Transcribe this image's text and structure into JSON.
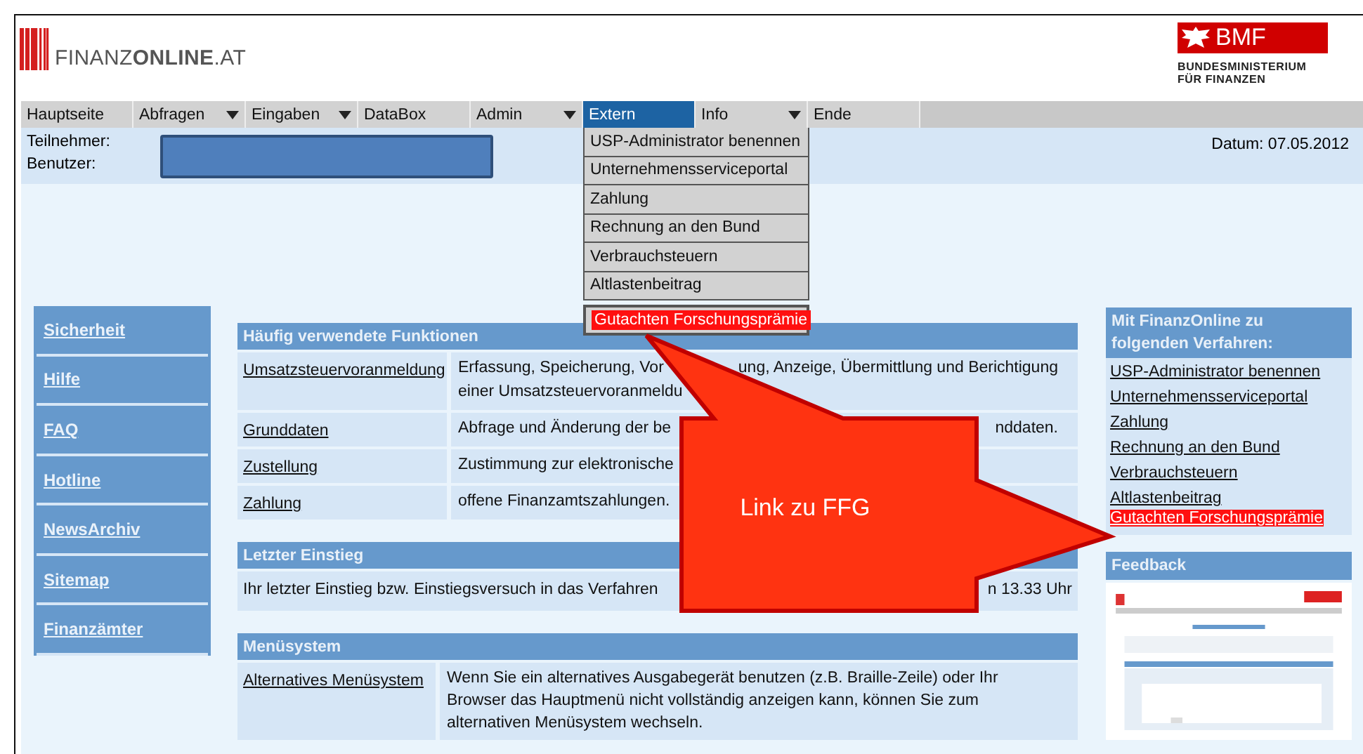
{
  "header": {
    "logo_text": "FINANZ**ONLINE**.AT",
    "ministry_short": "BMF",
    "ministry_lines": [
      "BUNDESMINISTERIUM",
      "FÜR FINANZEN"
    ]
  },
  "menu": [
    {
      "label": "Hauptseite",
      "has_dropdown": false,
      "selected": false
    },
    {
      "label": "Abfragen",
      "has_dropdown": true,
      "selected": false
    },
    {
      "label": "Eingaben",
      "has_dropdown": true,
      "selected": false
    },
    {
      "label": "DataBox",
      "has_dropdown": false,
      "selected": false
    },
    {
      "label": "Admin",
      "has_dropdown": true,
      "selected": false
    },
    {
      "label": "Extern",
      "has_dropdown": false,
      "selected": true
    },
    {
      "label": "Info",
      "has_dropdown": true,
      "selected": false
    },
    {
      "label": "Ende",
      "has_dropdown": false,
      "selected": false
    }
  ],
  "dropdown": [
    {
      "label": "USP-Administrator benennen",
      "highlighted": false
    },
    {
      "label": "Unternehmensserviceportal",
      "highlighted": false
    },
    {
      "label": "Zahlung",
      "highlighted": false
    },
    {
      "label": "Rechnung an den Bund",
      "highlighted": false
    },
    {
      "label": "Verbrauchsteuern",
      "highlighted": false
    },
    {
      "label": "Altlastenbeitrag",
      "highlighted": false
    },
    {
      "label": "Gutachten Forschungsprämie",
      "highlighted": true
    }
  ],
  "info": {
    "participant_label": "Teilnehmer:",
    "user_label": "Benutzer:",
    "date": "Datum: 07.05.2012"
  },
  "left_nav": [
    "Sicherheit",
    "Hilfe",
    "FAQ",
    "Hotline",
    "NewsArchiv",
    "Sitemap",
    "Finanzämter"
  ],
  "functions": {
    "title": "Häufig verwendete Funktionen",
    "rows": [
      {
        "link": "Umsatzsteuervoranmeldung",
        "lines": [
          {
            "left": "Erfassung, Speicherung, Vor",
            "right": "ung, Anzeige, Übermittlung und Berichtigung"
          },
          {
            "left": "einer Umsatzsteuervoranmeldu"
          }
        ]
      },
      {
        "link": "Grunddaten",
        "lines": [
          {
            "left": "Abfrage und Änderung der be",
            "right": "nddaten."
          }
        ]
      },
      {
        "link": "Zustellung",
        "lines": [
          {
            "left": "Zustimmung zur elektronische"
          }
        ]
      },
      {
        "link": "Zahlung",
        "lines": [
          {
            "left": "offene Finanzamtszahlungen."
          }
        ]
      }
    ]
  },
  "last_login": {
    "title": "Letzter Einstieg",
    "left": "Ihr letzter Einstieg bzw. Einstiegsversuch in das Verfahren",
    "right": "n 13.33 Uhr"
  },
  "menu_system": {
    "title": "Menüsystem",
    "link": "Alternatives Menüsystem",
    "lines": [
      "Wenn Sie ein alternatives Ausgabegerät benutzen (z.B. Braille-Zeile) oder Ihr",
      "Browser das Hauptmenü nicht vollständig anzeigen kann, können Sie zum",
      "alternativen Menüsystem wechseln."
    ]
  },
  "procedures": {
    "title": "Mit FinanzOnline zu folgenden Verfahren:",
    "links": [
      {
        "label": "USP-Administrator benennen",
        "highlighted": false
      },
      {
        "label": "Unternehmensserviceportal",
        "highlighted": false
      },
      {
        "label": "Zahlung",
        "highlighted": false
      },
      {
        "label": "Rechnung an den Bund",
        "highlighted": false
      },
      {
        "label": "Verbrauchsteuern",
        "highlighted": false
      },
      {
        "label": "Altlastenbeitrag",
        "highlighted": false
      },
      {
        "label": "Gutachten Forschungsprämie",
        "highlighted": true
      }
    ]
  },
  "feedback": {
    "title": "Feedback"
  },
  "callout": {
    "text": "Link zu FFG"
  }
}
